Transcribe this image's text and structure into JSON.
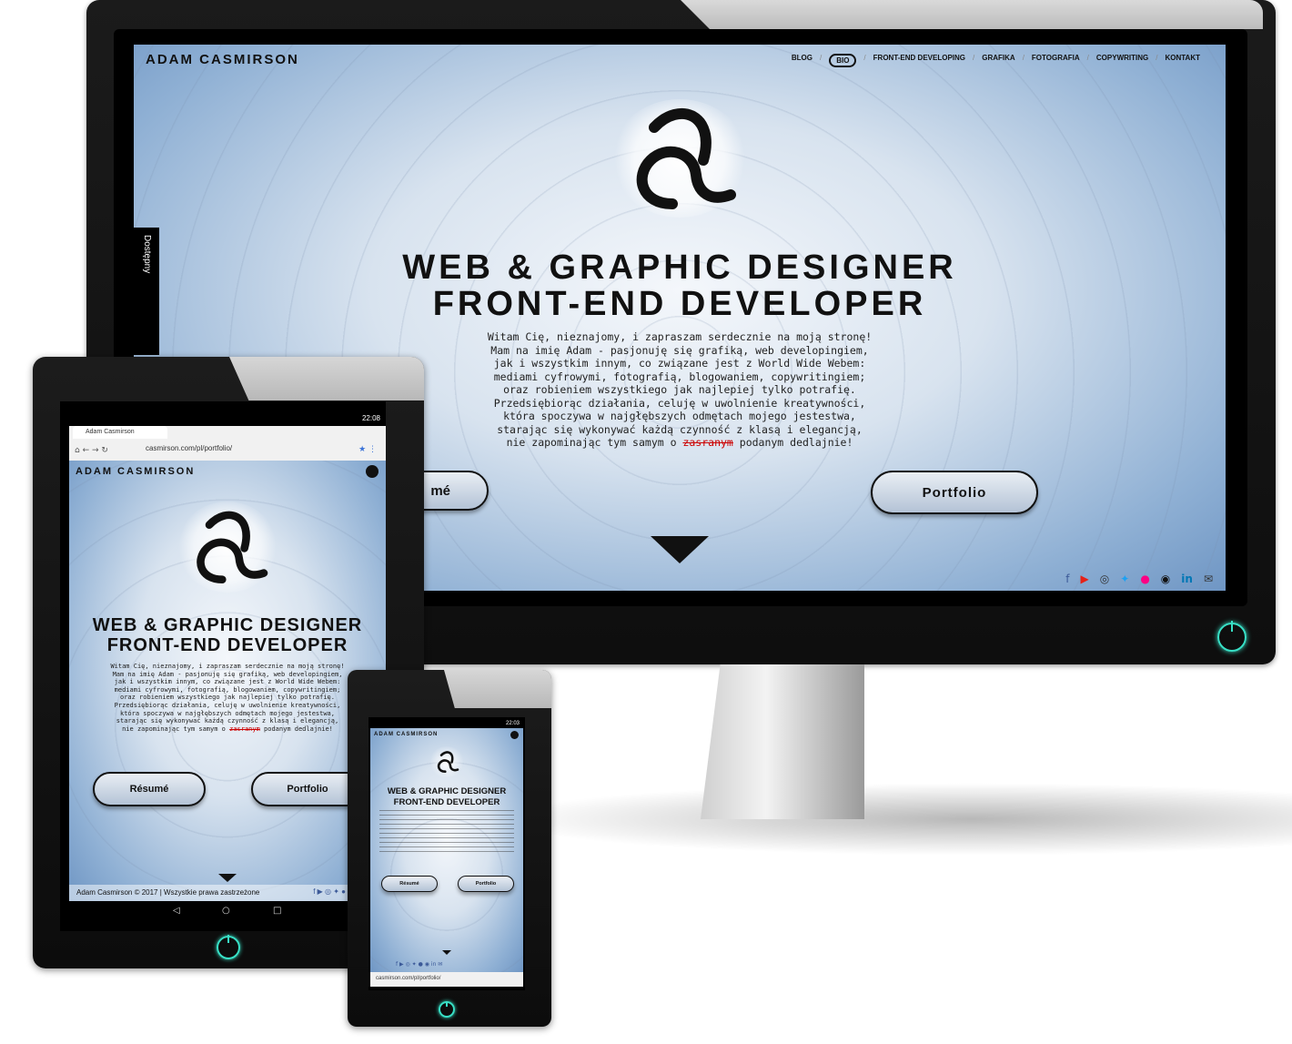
{
  "desktop": {
    "brand": "ADAM CASMIRSON",
    "nav": [
      "BLOG",
      "BIO",
      "FRONT-END DEVELOPING",
      "GRAFIKA",
      "FOTOGRAFIA",
      "COPYWRITING",
      "KONTAKT"
    ],
    "nav_active": "BIO",
    "side_tab": "Dostępny",
    "headline_1": "WEB & GRAPHIC DESIGNER",
    "headline_2": "FRONT-END DEVELOPER",
    "intro_lines": [
      "Witam Cię, nieznajomy, i zapraszam serdecznie na moją stronę!",
      "Mam na imię Adam - pasjonuję się grafiką, web developingiem,",
      "jak i wszystkim innym, co związane jest z World Wide Webem:",
      "mediami cyfrowymi, fotografią, blogowaniem, copywritingiem;",
      "oraz robieniem wszystkiego jak najlepiej tylko potrafię.",
      "Przedsiębiorąc działania, celuję w uwolnienie kreatywności,",
      "która spoczywa w najgłębszych odmętach mojego jestestwa,",
      "starając się wykonywać każdą czynność z klasą i elegancją,"
    ],
    "intro_last_pre": "nie zapominając tym samym o ",
    "intro_last_strike": "zasranym",
    "intro_last_post": " podanym dedlajnie!",
    "resume_partial": "mé",
    "portfolio": "Portfolio",
    "social_icons": [
      "facebook-icon",
      "youtube-icon",
      "instagram-icon",
      "twitter-icon",
      "flickr-icon",
      "github-icon",
      "linkedin-icon",
      "mail-icon"
    ]
  },
  "tablet": {
    "status_time": "22:08",
    "tab_title": "Adam Casmirson",
    "url": "casmirson.com/pl/portfolio/",
    "brand": "ADAM CASMIRSON",
    "headline_1": "WEB & GRAPHIC DESIGNER",
    "headline_2": "FRONT-END DEVELOPER",
    "intro_lines": [
      "Witam Cię, nieznajomy, i zapraszam serdecznie na moją stronę!",
      "Mam na imię Adam - pasjonuję się grafiką, web developingiem,",
      "jak i wszystkim innym, co związane jest z World Wide Webem:",
      "mediami cyfrowymi, fotografią, blogowaniem, copywritingiem;",
      "oraz robieniem wszystkiego jak najlepiej tylko potrafię.",
      "Przedsiębiorąc działania, celuję w uwolnienie kreatywności,",
      "która spoczywa w najgłębszych odmętach mojego jestestwa,",
      "starając się wykonywać każdą czynność z klasą i elegancją,"
    ],
    "intro_last_pre": "nie zapominając tym samym o ",
    "intro_last_strike": "zasranym",
    "intro_last_post": " podanym dedlajnie!",
    "resume": "Résumé",
    "portfolio": "Portfolio",
    "footer": "Adam Casmirson © 2017 | Wszystkie prawa zastrzeżone"
  },
  "phone": {
    "status_time": "22:03",
    "brand": "ADAM CASMIRSON",
    "headline_1": "WEB & GRAPHIC DESIGNER",
    "headline_2": "FRONT-END DEVELOPER",
    "resume": "Résumé",
    "portfolio": "Portfolio",
    "url": "casmirson.com/pl/portfolio/"
  },
  "colors": {
    "power_accent": "#38e0c6",
    "strike_red": "#cc0000"
  }
}
